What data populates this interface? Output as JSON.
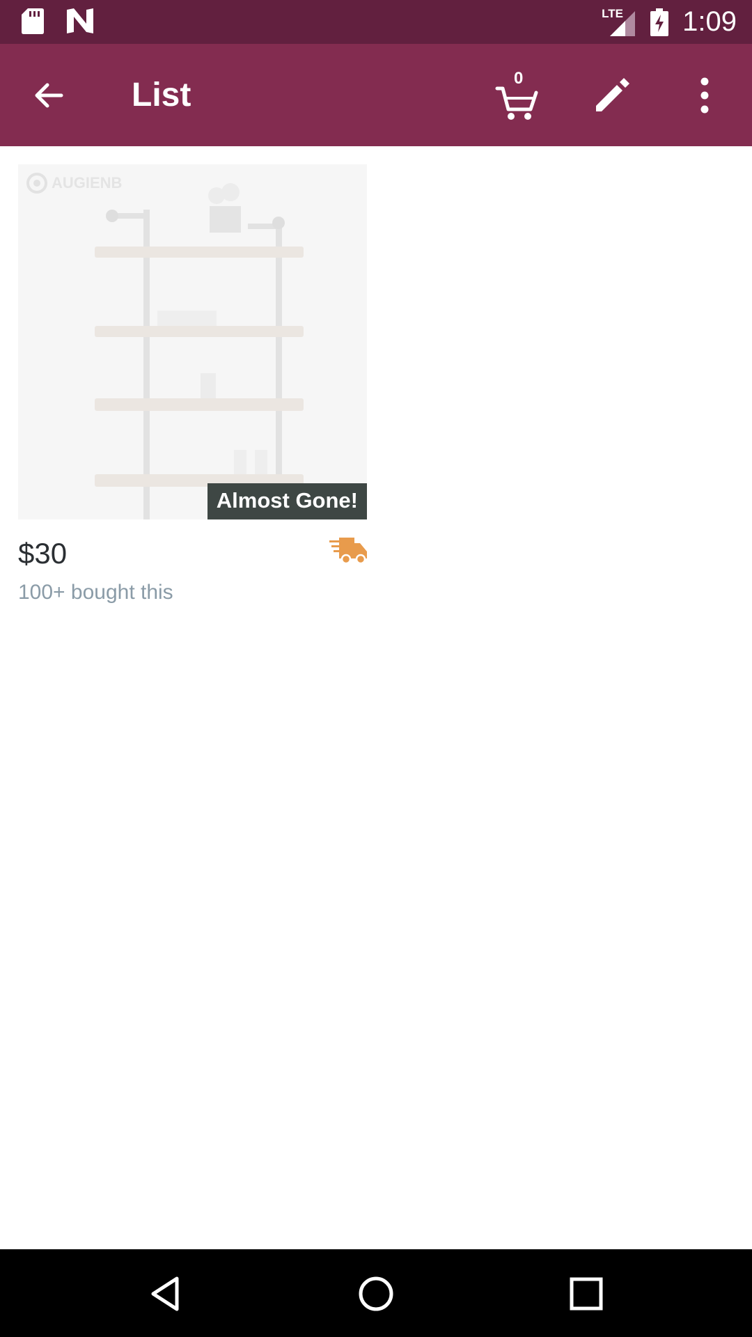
{
  "status_bar": {
    "time": "1:09",
    "network": "LTE",
    "icons": [
      "sd-card-icon",
      "n-logo-icon",
      "signal-icon",
      "battery-charging-icon"
    ]
  },
  "app_bar": {
    "title": "List",
    "cart_count": "0",
    "icons": [
      "back-arrow-icon",
      "cart-icon",
      "pencil-icon",
      "more-vert-icon"
    ]
  },
  "product": {
    "brand": "AUGIENB",
    "badge": "Almost Gone!",
    "price": "$30",
    "bought": "100+ bought this",
    "shipping_icon": "fast-shipping-truck-icon",
    "colors": {
      "badge_bg": "#3e4744",
      "truck": "#e89b4c",
      "bought_text": "#8a9ba7"
    }
  },
  "nav_bar": {
    "icons": [
      "nav-back-icon",
      "nav-home-icon",
      "nav-recents-icon"
    ]
  },
  "colors": {
    "status_bar": "#62203f",
    "app_bar": "#832c50"
  }
}
